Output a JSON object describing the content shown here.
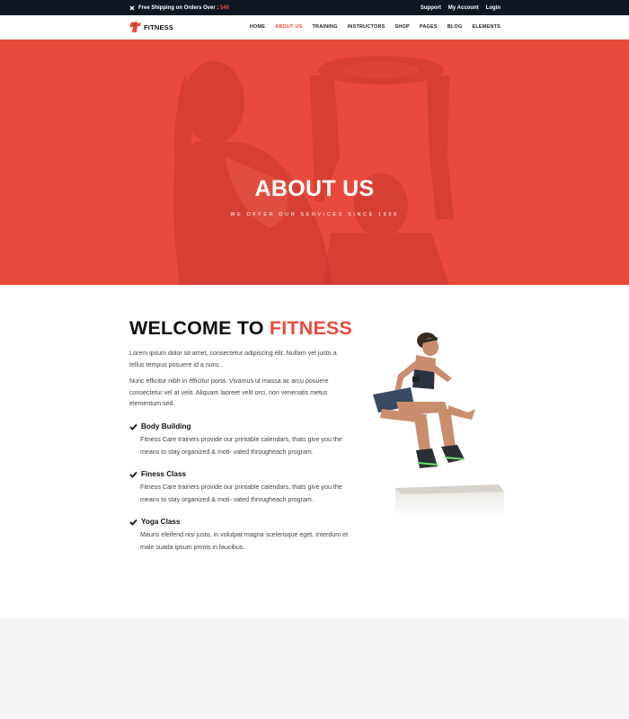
{
  "topbar": {
    "shipping_text": "Free Shipping on Orders Over :",
    "shipping_amount": "$40",
    "links": [
      "Support",
      "My Account",
      "Login"
    ]
  },
  "navbar": {
    "logo_text": "FITNESS",
    "menu": [
      "HOME",
      "ABOUT US",
      "TRAINING",
      "INSTRUCTORS",
      "SHOP",
      "PAGES",
      "BLOG",
      "ELEMENTS"
    ],
    "active": "ABOUT US"
  },
  "hero": {
    "title": "ABOUT US",
    "subtitle": "WE OFFER OUR SERVICES SINCE 1996"
  },
  "welcome": {
    "heading_prefix": "WELCOME TO",
    "heading_accent": "FITNESS",
    "paragraphs": [
      "Lorem ipsum dolor sit amet, consectetur adipiscing elit. Nullam vel justo a tellus tempus posuere id a nunc..",
      "Nunc efficitur nibh in efficitur porta. Vivamus ut massa ac arcu posuere consectetur vel at velit. Aliquam laoreet velit orci, non venenatis metus elementum sed."
    ],
    "features": [
      {
        "title": "Body Building",
        "text": "Fitness Care trainers provide our printable calendars, thats give you the means to stay organized & moti- vated througheach program."
      },
      {
        "title": "Finess Class",
        "text": "Fitness Care trainers provide our printable calendars, thats give you the means to stay organized & moti- vated througheach program."
      },
      {
        "title": "Yoga Class",
        "text": "Mauris eleifend nisi justo, in volutpat magna scelerisque eget. Interdum et male suada ipsum primis in faucibus."
      }
    ]
  },
  "colors": {
    "accent": "#e74c3c",
    "topbar_bg": "#0f1722",
    "hero_bg": "#e94a3b"
  }
}
